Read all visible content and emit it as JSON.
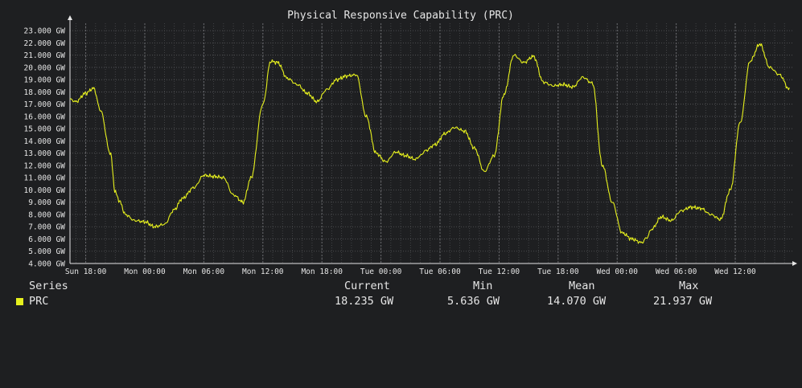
{
  "chart_data": {
    "type": "line",
    "title": "Physical Responsive Capability (PRC)",
    "y_unit": "GW",
    "ylim": [
      4,
      23.6
    ],
    "y_ticks": [
      "4.000 GW",
      "5.000 GW",
      "6.000 GW",
      "7.000 GW",
      "8.000 GW",
      "9.000 GW",
      "10.000 GW",
      "11.000 GW",
      "12.000 GW",
      "13.000 GW",
      "14.000 GW",
      "15.000 GW",
      "16.000 GW",
      "17.000 GW",
      "18.000 GW",
      "19.000 GW",
      "20.000 GW",
      "21.000 GW",
      "22.000 GW",
      "23.000 GW"
    ],
    "x_ticks": [
      "Sun 18:00",
      "Mon 00:00",
      "Mon 06:00",
      "Mon 12:00",
      "Mon 18:00",
      "Tue 00:00",
      "Tue 06:00",
      "Tue 12:00",
      "Tue 18:00",
      "Wed 00:00",
      "Wed 06:00",
      "Wed 12:00"
    ],
    "x_unit": "hours from Sun 18:00",
    "xlim": [
      -1.6,
      71.8
    ],
    "grid": true,
    "series": [
      {
        "name": "PRC",
        "color": "#e6f01e",
        "x": [
          -1.6,
          -1.0,
          0.0,
          0.8,
          1.5,
          2.5,
          3.0,
          3.5,
          4.0,
          5.0,
          6.0,
          7.0,
          8.0,
          9.0,
          9.8,
          11.0,
          12.0,
          13.0,
          14.0,
          15.0,
          16.0,
          16.8,
          18.0,
          18.8,
          19.5,
          20.5,
          21.5,
          22.5,
          23.5,
          24.5,
          25.5,
          26.5,
          27.5,
          28.5,
          29.5,
          30.5,
          31.5,
          32.5,
          33.5,
          34.0,
          34.5,
          35.5,
          36.5,
          37.5,
          38.5,
          39.5,
          40.5,
          41.5,
          42.5,
          43.5,
          44.5,
          45.5,
          46.5,
          47.5,
          48.5,
          49.5,
          50.5,
          51.5,
          52.5,
          53.5,
          54.5,
          55.5,
          56.5,
          57.0,
          57.5,
          58.5,
          59.5,
          60.5,
          61.5,
          62.5,
          63.5,
          64.5,
          65.5,
          66.5,
          67.5,
          68.5,
          69.5,
          70.5,
          71.5
        ],
        "y": [
          17.4,
          17.2,
          17.9,
          18.3,
          16.5,
          13.0,
          9.8,
          9.0,
          8.0,
          7.5,
          7.4,
          7.0,
          7.2,
          8.4,
          9.3,
          10.2,
          11.2,
          11.1,
          11.0,
          9.6,
          9.0,
          11.0,
          17.0,
          20.5,
          20.4,
          19.1,
          18.6,
          17.9,
          17.2,
          18.2,
          19.0,
          19.3,
          19.4,
          16.0,
          13.0,
          12.3,
          13.1,
          12.8,
          12.5,
          12.8,
          13.2,
          13.7,
          14.6,
          15.1,
          14.8,
          13.4,
          11.5,
          12.8,
          17.8,
          21.0,
          20.4,
          20.9,
          18.8,
          18.5,
          18.6,
          18.4,
          19.2,
          18.7,
          12.0,
          9.0,
          6.5,
          6.0,
          5.7,
          6.1,
          6.8,
          7.8,
          7.5,
          8.3,
          8.6,
          8.5,
          8.0,
          7.6,
          10.0,
          15.5,
          20.5,
          21.9,
          20.0,
          19.4,
          18.2
        ]
      }
    ]
  },
  "legend": {
    "headers": {
      "series": "Series",
      "current": "Current",
      "min": "Min",
      "mean": "Mean",
      "max": "Max"
    },
    "rows": [
      {
        "name": "PRC",
        "color": "#e6f01e",
        "current": "18.235 GW",
        "min": "5.636 GW",
        "mean": "14.070 GW",
        "max": "21.937 GW"
      }
    ]
  }
}
